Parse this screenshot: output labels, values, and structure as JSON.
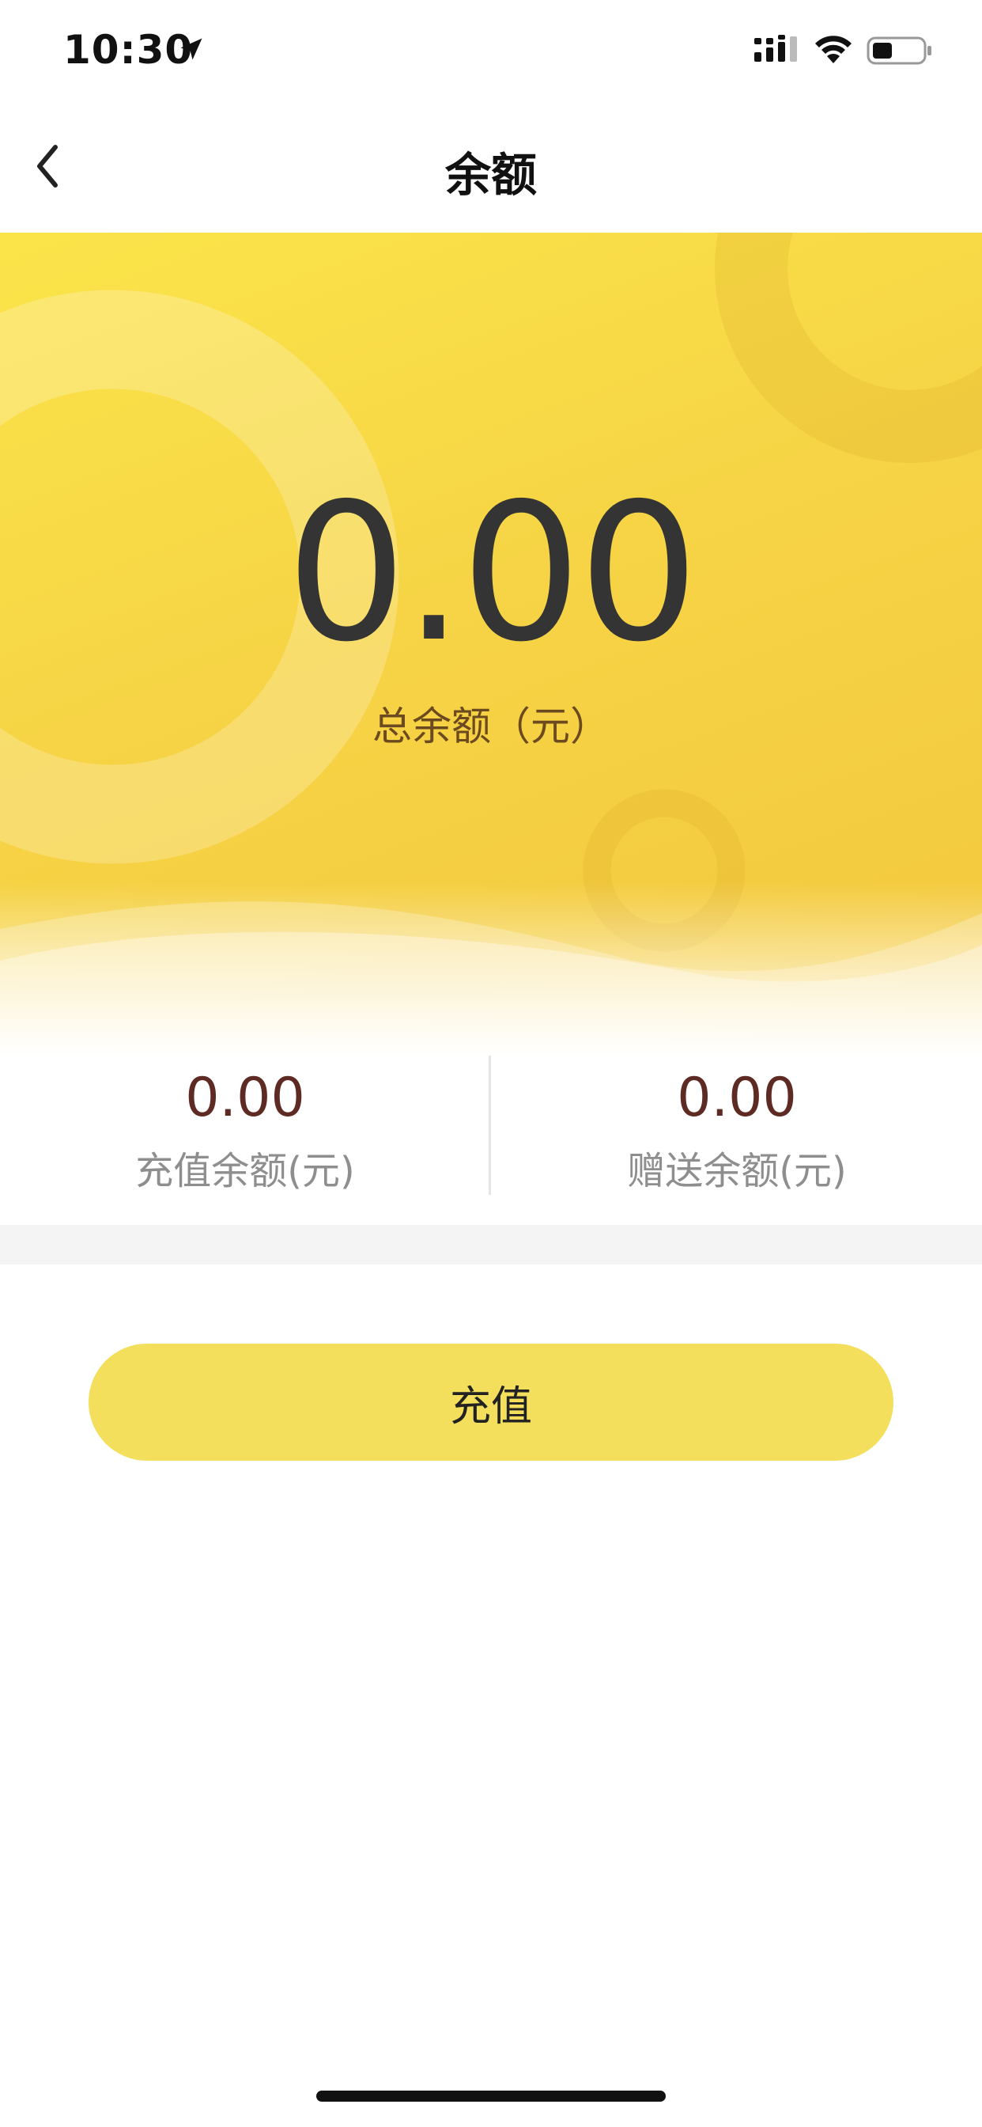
{
  "status_bar": {
    "time": "10:30",
    "icons": [
      "location-arrow-icon",
      "signal-icon",
      "wifi-icon",
      "battery-icon"
    ]
  },
  "nav": {
    "title": "余额",
    "back_icon": "chevron-left-icon"
  },
  "balance": {
    "total_value": "0.00",
    "total_label": "总余额（元）",
    "recharge_value": "0.00",
    "recharge_label": "充值余额(元)",
    "gift_value": "0.00",
    "gift_label": "赠送余额(元)"
  },
  "actions": {
    "recharge_button_label": "充值"
  },
  "colors": {
    "accent_yellow": "#f6d445",
    "button_yellow": "#f3df5b",
    "value_brown": "#5e2b24",
    "total_text": "#343434"
  }
}
